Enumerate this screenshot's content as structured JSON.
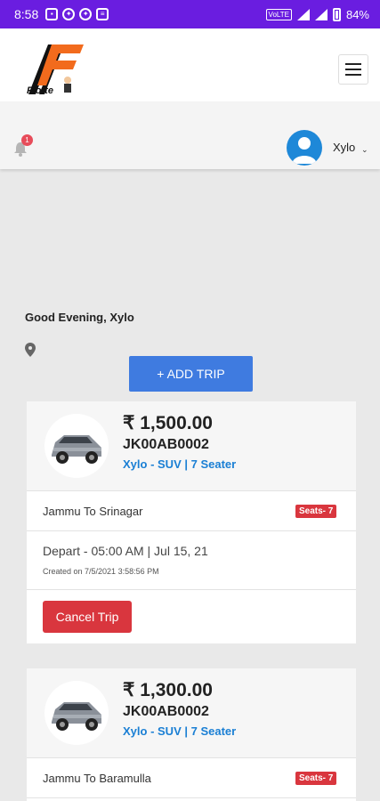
{
  "status_bar": {
    "time": "8:58",
    "volte": "VoLTE",
    "battery": "84%"
  },
  "header": {
    "logo_text": "Flotte"
  },
  "user": {
    "name": "Xylo",
    "notification_count": "1"
  },
  "greeting": "Good Evening, Xylo",
  "add_trip_label": "+ ADD TRIP",
  "trips": [
    {
      "price": "₹ 1,500.00",
      "registration": "JK00AB0002",
      "vehicle": "Xylo - SUV | 7 Seater",
      "route": "Jammu To Srinagar",
      "seats": "Seats- 7",
      "depart": "Depart - 05:00 AM | Jul 15, 21",
      "created": "Created on 7/5/2021 3:58:56 PM",
      "cancel_label": "Cancel Trip"
    },
    {
      "price": "₹ 1,300.00",
      "registration": "JK00AB0002",
      "vehicle": "Xylo - SUV | 7 Seater",
      "route": "Jammu To Baramulla",
      "seats": "Seats- 7"
    }
  ],
  "colors": {
    "status_bar": "#6a1de0",
    "primary": "#3f7be0",
    "danger": "#d9363e",
    "link": "#1a7fd4",
    "avatar": "#1e88d8",
    "logo_orange": "#f26b1d"
  }
}
